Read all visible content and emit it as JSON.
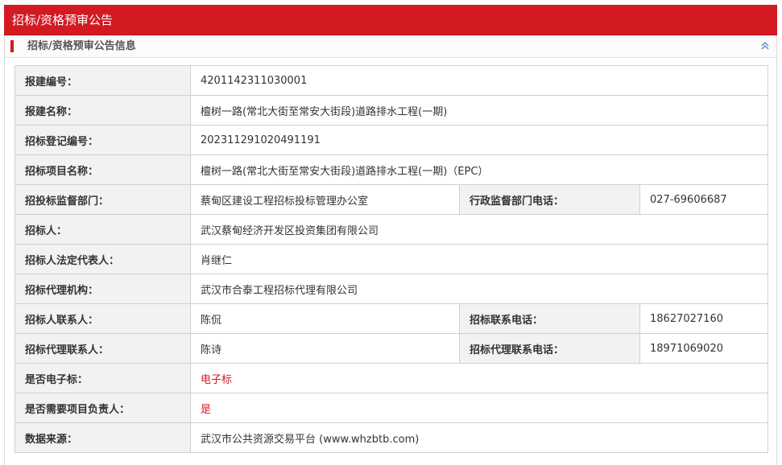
{
  "title_bar": {
    "title": "招标/资格预审公告"
  },
  "section": {
    "title": "招标/资格预审公告信息",
    "collapse_icon": "double-chevron-up-icon"
  },
  "rows": [
    {
      "label": "报建编号：",
      "value": "4201142311030001"
    },
    {
      "label": "报建名称：",
      "value": "檀树一路(常北大街至常安大街段)道路排水工程(一期)"
    },
    {
      "label": "招标登记编号：",
      "value": "202311291020491191"
    },
    {
      "label": "招标项目名称：",
      "value": "檀树一路(常北大街至常安大街段)道路排水工程(一期)（EPC）"
    },
    {
      "label": "招投标监督部门：",
      "value": "蔡甸区建设工程招标投标管理办公室",
      "label2": "行政监督部门电话：",
      "value2": "027-69606687"
    },
    {
      "label": "招标人：",
      "value": "武汉蔡甸经济开发区投资集团有限公司"
    },
    {
      "label": "招标人法定代表人：",
      "value": "肖继仁"
    },
    {
      "label": "招标代理机构：",
      "value": "武汉市合泰工程招标代理有限公司"
    },
    {
      "label": "招标人联系人：",
      "value": "陈侃",
      "label2": "招标联系电话：",
      "value2": "18627027160"
    },
    {
      "label": "招标代理联系人：",
      "value": "陈诗",
      "label2": "招标代理联系电话：",
      "value2": "18971069020"
    },
    {
      "label": "是否电子标：",
      "value": "电子标",
      "value_color": "red"
    },
    {
      "label": "是否需要项目负责人：",
      "value": "是",
      "value_color": "red"
    },
    {
      "label": "数据来源：",
      "value": " 武汉市公共资源交易平台 (www.whzbtb.com)"
    }
  ],
  "colors": {
    "accent": "#d31a22",
    "label_bg": "#f2f2f2",
    "border": "#d0d0d0"
  }
}
